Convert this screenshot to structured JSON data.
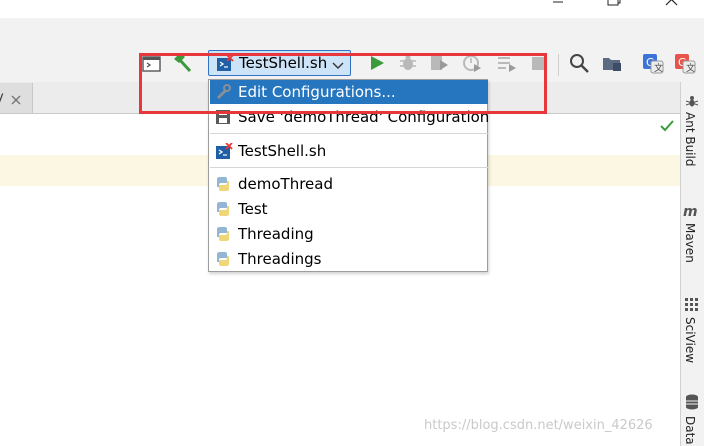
{
  "window": {
    "controls": [
      "minimize-icon",
      "maximize-icon",
      "close-icon"
    ]
  },
  "toolbar": {
    "run_config": {
      "label": "TestShell.sh",
      "icon": "shell-script-error-icon"
    },
    "icons": [
      "project-structure-icon",
      "build-hammer-icon",
      "run-icon",
      "debug-icon",
      "coverage-icon",
      "profile-icon",
      "run-to-cursor-icon",
      "stop-icon",
      "search-icon",
      "folder-icon",
      "translate-google-icon",
      "translate-icon"
    ]
  },
  "editor": {
    "tab": {
      "label": "y"
    }
  },
  "dropdown": {
    "items": [
      {
        "label": "Edit Configurations...",
        "icon": "wrench-icon",
        "selected": true
      },
      {
        "label": "Save 'demoThread' Configuration",
        "icon": "save-icon",
        "selected": false
      },
      {
        "label": "TestShell.sh",
        "icon": "shell-script-error-icon",
        "selected": false
      },
      {
        "label": "demoThread",
        "icon": "python-icon",
        "selected": false
      },
      {
        "label": "Test",
        "icon": "python-icon",
        "selected": false
      },
      {
        "label": "Threading",
        "icon": "python-icon",
        "selected": false
      },
      {
        "label": "Threadings",
        "icon": "python-icon",
        "selected": false
      }
    ]
  },
  "right_sidebar": {
    "tools": [
      {
        "label": "Ant Build",
        "icon": "ant-icon"
      },
      {
        "label": "Maven",
        "icon": "maven-icon"
      },
      {
        "label": "SciView",
        "icon": "sciview-icon"
      },
      {
        "label": "Data",
        "icon": "database-icon"
      }
    ]
  },
  "watermark": "https://blog.csdn.net/weixin_42626",
  "colors": {
    "highlight": "#e8363d",
    "selection": "#2675bf",
    "run_green": "#3c9a3c"
  }
}
